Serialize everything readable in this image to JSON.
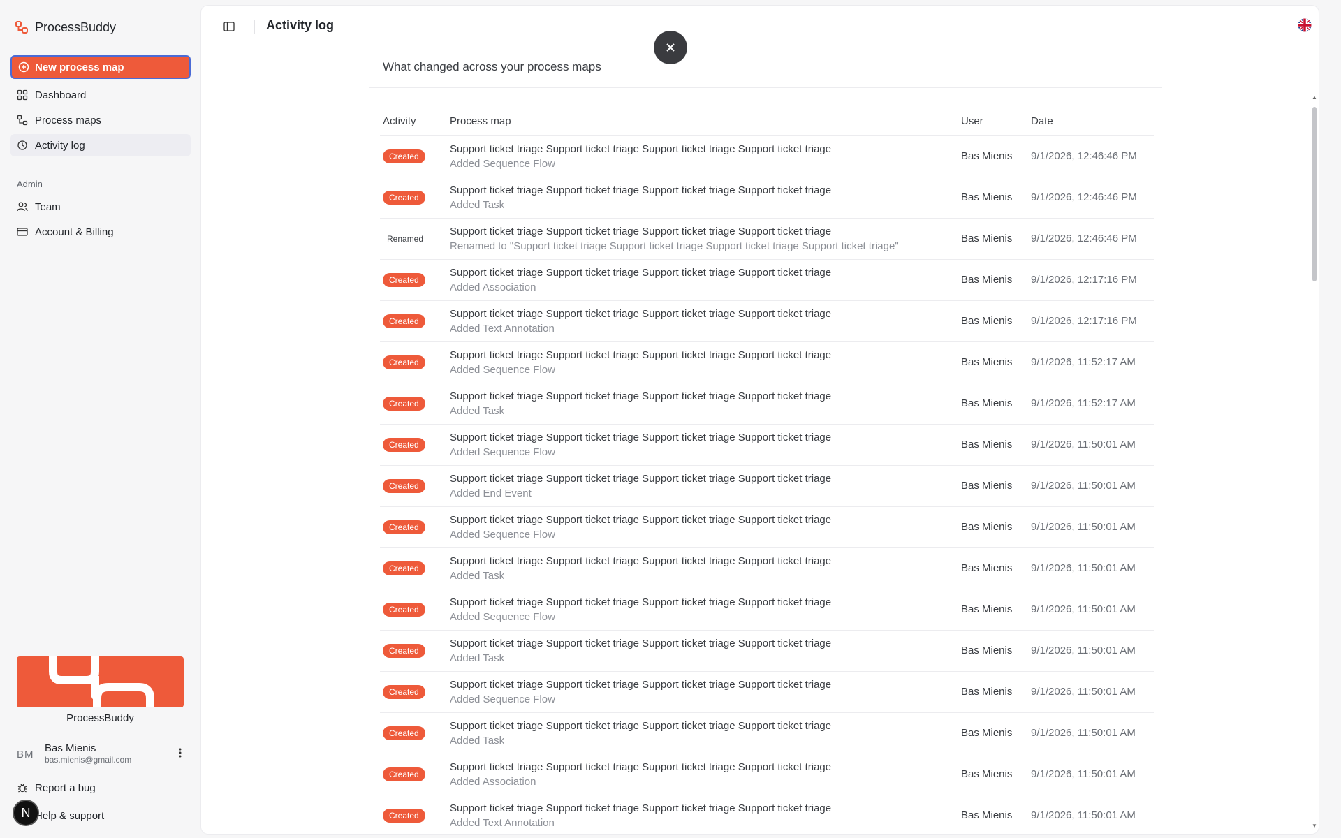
{
  "sidebar": {
    "brand": "ProcessBuddy",
    "new_button": "New process map",
    "nav": [
      {
        "label": "Dashboard",
        "icon": "grid-icon"
      },
      {
        "label": "Process maps",
        "icon": "process-icon"
      },
      {
        "label": "Activity log",
        "icon": "history-icon",
        "active": true
      }
    ],
    "admin_label": "Admin",
    "admin_nav": [
      {
        "label": "Team",
        "icon": "users-icon"
      },
      {
        "label": "Account & Billing",
        "icon": "card-icon"
      }
    ],
    "promo_label": "ProcessBuddy",
    "user": {
      "initials": "BM",
      "name": "Bas Mienis",
      "email": "bas.mienis@gmail.com"
    },
    "footer": {
      "report_bug": "Report a bug",
      "help": "Help & support"
    },
    "badge_letter": "N"
  },
  "header": {
    "title": "Activity log"
  },
  "main": {
    "subtitle": "What changed across your process maps",
    "columns": [
      "Activity",
      "Process map",
      "User",
      "Date"
    ],
    "rows": [
      {
        "activity": "Created",
        "map": "Support ticket triage Support ticket triage Support ticket triage Support ticket triage",
        "detail": "Added Sequence Flow",
        "user": "Bas Mienis",
        "date": "9/1/2026, 12:46:46 PM"
      },
      {
        "activity": "Created",
        "map": "Support ticket triage Support ticket triage Support ticket triage Support ticket triage",
        "detail": "Added Task",
        "user": "Bas Mienis",
        "date": "9/1/2026, 12:46:46 PM"
      },
      {
        "activity": "Renamed",
        "map": "Support ticket triage Support ticket triage Support ticket triage Support ticket triage",
        "detail": "Renamed to \"Support ticket triage Support ticket triage Support ticket triage Support ticket triage\"",
        "user": "Bas Mienis",
        "date": "9/1/2026, 12:46:46 PM"
      },
      {
        "activity": "Created",
        "map": "Support ticket triage Support ticket triage Support ticket triage Support ticket triage",
        "detail": "Added Association",
        "user": "Bas Mienis",
        "date": "9/1/2026, 12:17:16 PM"
      },
      {
        "activity": "Created",
        "map": "Support ticket triage Support ticket triage Support ticket triage Support ticket triage",
        "detail": "Added Text Annotation",
        "user": "Bas Mienis",
        "date": "9/1/2026, 12:17:16 PM"
      },
      {
        "activity": "Created",
        "map": "Support ticket triage Support ticket triage Support ticket triage Support ticket triage",
        "detail": "Added Sequence Flow",
        "user": "Bas Mienis",
        "date": "9/1/2026, 11:52:17 AM"
      },
      {
        "activity": "Created",
        "map": "Support ticket triage Support ticket triage Support ticket triage Support ticket triage",
        "detail": "Added Task",
        "user": "Bas Mienis",
        "date": "9/1/2026, 11:52:17 AM"
      },
      {
        "activity": "Created",
        "map": "Support ticket triage Support ticket triage Support ticket triage Support ticket triage",
        "detail": "Added Sequence Flow",
        "user": "Bas Mienis",
        "date": "9/1/2026, 11:50:01 AM"
      },
      {
        "activity": "Created",
        "map": "Support ticket triage Support ticket triage Support ticket triage Support ticket triage",
        "detail": "Added End Event",
        "user": "Bas Mienis",
        "date": "9/1/2026, 11:50:01 AM"
      },
      {
        "activity": "Created",
        "map": "Support ticket triage Support ticket triage Support ticket triage Support ticket triage",
        "detail": "Added Sequence Flow",
        "user": "Bas Mienis",
        "date": "9/1/2026, 11:50:01 AM"
      },
      {
        "activity": "Created",
        "map": "Support ticket triage Support ticket triage Support ticket triage Support ticket triage",
        "detail": "Added Task",
        "user": "Bas Mienis",
        "date": "9/1/2026, 11:50:01 AM"
      },
      {
        "activity": "Created",
        "map": "Support ticket triage Support ticket triage Support ticket triage Support ticket triage",
        "detail": "Added Sequence Flow",
        "user": "Bas Mienis",
        "date": "9/1/2026, 11:50:01 AM"
      },
      {
        "activity": "Created",
        "map": "Support ticket triage Support ticket triage Support ticket triage Support ticket triage",
        "detail": "Added Task",
        "user": "Bas Mienis",
        "date": "9/1/2026, 11:50:01 AM"
      },
      {
        "activity": "Created",
        "map": "Support ticket triage Support ticket triage Support ticket triage Support ticket triage",
        "detail": "Added Sequence Flow",
        "user": "Bas Mienis",
        "date": "9/1/2026, 11:50:01 AM"
      },
      {
        "activity": "Created",
        "map": "Support ticket triage Support ticket triage Support ticket triage Support ticket triage",
        "detail": "Added Task",
        "user": "Bas Mienis",
        "date": "9/1/2026, 11:50:01 AM"
      },
      {
        "activity": "Created",
        "map": "Support ticket triage Support ticket triage Support ticket triage Support ticket triage",
        "detail": "Added Association",
        "user": "Bas Mienis",
        "date": "9/1/2026, 11:50:01 AM"
      },
      {
        "activity": "Created",
        "map": "Support ticket triage Support ticket triage Support ticket triage Support ticket triage",
        "detail": "Added Text Annotation",
        "user": "Bas Mienis",
        "date": "9/1/2026, 11:50:01 AM"
      }
    ]
  },
  "colors": {
    "accent": "#ee5a3a",
    "focus_ring": "#4b6bd6"
  }
}
